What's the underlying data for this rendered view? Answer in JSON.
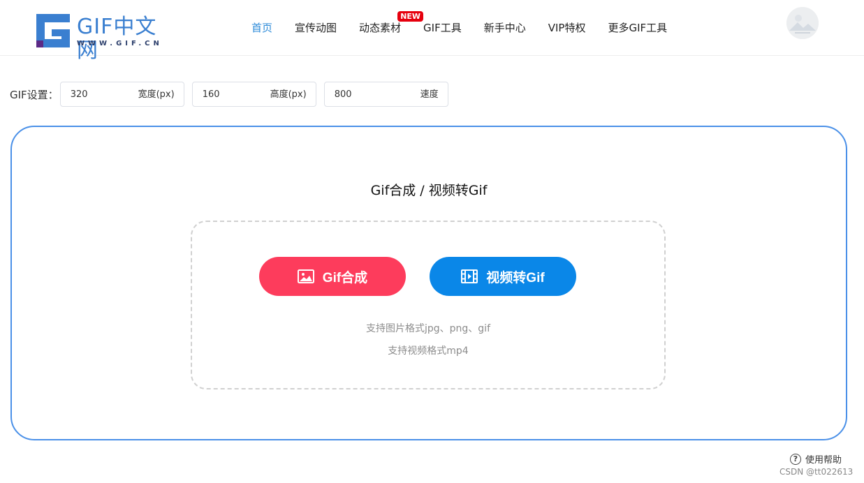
{
  "header": {
    "logo": {
      "title": "GIF中文网",
      "url": "WWW.GIF.CN"
    },
    "nav": [
      {
        "label": "首页",
        "active": true
      },
      {
        "label": "宣传动图"
      },
      {
        "label": "动态素材",
        "badge": "NEW"
      },
      {
        "label": "GIF工具"
      },
      {
        "label": "新手中心"
      },
      {
        "label": "VIP特权"
      },
      {
        "label": "更多GIF工具"
      }
    ],
    "avatar_icon": "user-avatar-icon"
  },
  "settings": {
    "label": "GIF设置：",
    "width": {
      "value": "320",
      "suffix": "宽度(px)"
    },
    "height": {
      "value": "160",
      "suffix": "高度(px)"
    },
    "speed": {
      "value": "800",
      "suffix": "速度"
    }
  },
  "main": {
    "title": "Gif合成 / 视频转Gif",
    "buttons": {
      "gif_compose": {
        "label": "Gif合成",
        "icon": "image-icon",
        "color": "#fd3c5c"
      },
      "video_to_gif": {
        "label": "视频转Gif",
        "icon": "film-icon",
        "color": "#0a87e8"
      }
    },
    "hints": {
      "image_formats": "支持图片格式jpg、png、gif",
      "video_formats": "支持视频格式mp4"
    }
  },
  "footer": {
    "help": "使用帮助",
    "watermark": "CSDN @tt022613"
  },
  "colors": {
    "accent": "#4a90e8",
    "nav_active": "#2b8ad8",
    "badge": "#e6000e"
  }
}
